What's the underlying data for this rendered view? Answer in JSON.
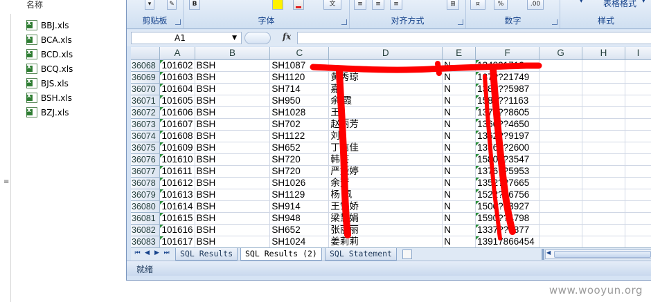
{
  "explorer": {
    "column_header": "名称",
    "files": [
      "BBJ.xls",
      "BCA.xls",
      "BCD.xls",
      "BCQ.xls",
      "BJS.xls",
      "BSH.xls",
      "BZJ.xls"
    ]
  },
  "ribbon": {
    "groups": [
      "剪贴板",
      "字体",
      "对齐方式",
      "数字",
      "样式"
    ],
    "number_format": "%",
    "number_decimals": ".00",
    "table_format": "表格格式"
  },
  "formula_bar": {
    "name_box": "A1",
    "fx": "fx",
    "value": ""
  },
  "grid": {
    "columns": [
      "A",
      "B",
      "C",
      "D",
      "E",
      "F",
      "G",
      "H",
      "I"
    ],
    "rows": [
      {
        "n": "36068",
        "a": "101602",
        "b": "BSH",
        "c": "SH1087",
        "d": "",
        "e": "N",
        "f": "13482171?"
      },
      {
        "n": "36069",
        "a": "101603",
        "b": "BSH",
        "c": "SH1120",
        "d": "黄秀琼",
        "e": "N",
        "f": "137??21749"
      },
      {
        "n": "36070",
        "a": "101604",
        "b": "BSH",
        "c": "SH714",
        "d": "嘉",
        "e": "N",
        "f": "1381??5987"
      },
      {
        "n": "36071",
        "a": "101605",
        "b": "BSH",
        "c": "SH950",
        "d": "余 霞",
        "e": "N",
        "f": "1582??1163"
      },
      {
        "n": "36072",
        "a": "101606",
        "b": "BSH",
        "c": "SH1028",
        "d": "王",
        "e": "N",
        "f": "1373??8605"
      },
      {
        "n": "36073",
        "a": "101607",
        "b": "BSH",
        "c": "SH702",
        "d": "赵丽芳",
        "e": "N",
        "f": "1366??4650"
      },
      {
        "n": "36074",
        "a": "101608",
        "b": "BSH",
        "c": "SH1122",
        "d": "刘",
        "e": "N",
        "f": "1362??9197"
      },
      {
        "n": "36075",
        "a": "101609",
        "b": "BSH",
        "c": "SH652",
        "d": "丁信佳",
        "e": "N",
        "f": "1376??2600"
      },
      {
        "n": "36076",
        "a": "101610",
        "b": "BSH",
        "c": "SH720",
        "d": "韩芸",
        "e": "N",
        "f": "1580??3547"
      },
      {
        "n": "36077",
        "a": "101611",
        "b": "BSH",
        "c": "SH720",
        "d": "严娅婷",
        "e": "N",
        "f": "1376??5953"
      },
      {
        "n": "36078",
        "a": "101612",
        "b": "BSH",
        "c": "SH1026",
        "d": "余芳",
        "e": "N",
        "f": "1352??7665"
      },
      {
        "n": "36079",
        "a": "101613",
        "b": "BSH",
        "c": "SH1129",
        "d": "杨 佩",
        "e": "N",
        "f": "1522??6756"
      },
      {
        "n": "36080",
        "a": "101614",
        "b": "BSH",
        "c": "SH914",
        "d": "王雪娇",
        "e": "N",
        "f": "1500??3927"
      },
      {
        "n": "36081",
        "a": "101615",
        "b": "BSH",
        "c": "SH948",
        "d": "梁慧娟",
        "e": "N",
        "f": "1590??4798"
      },
      {
        "n": "36082",
        "a": "101616",
        "b": "BSH",
        "c": "SH652",
        "d": "张丽丽",
        "e": "N",
        "f": "1337??7877"
      },
      {
        "n": "36083",
        "a": "101617",
        "b": "BSH",
        "c": "SH1024",
        "d": "姜莉莉",
        "e": "N",
        "f": "13917866454"
      }
    ]
  },
  "sheets": {
    "tabs": [
      "SQL Results",
      "SQL Results (2)",
      "SQL Statement"
    ],
    "active": 1
  },
  "status_bar": {
    "text": "就绪"
  },
  "watermark": "www.wooyun.org",
  "colors": {
    "marker": "#ff0000",
    "ribbon_text": "#15428b",
    "cell_marker": "#2a8f3a"
  }
}
